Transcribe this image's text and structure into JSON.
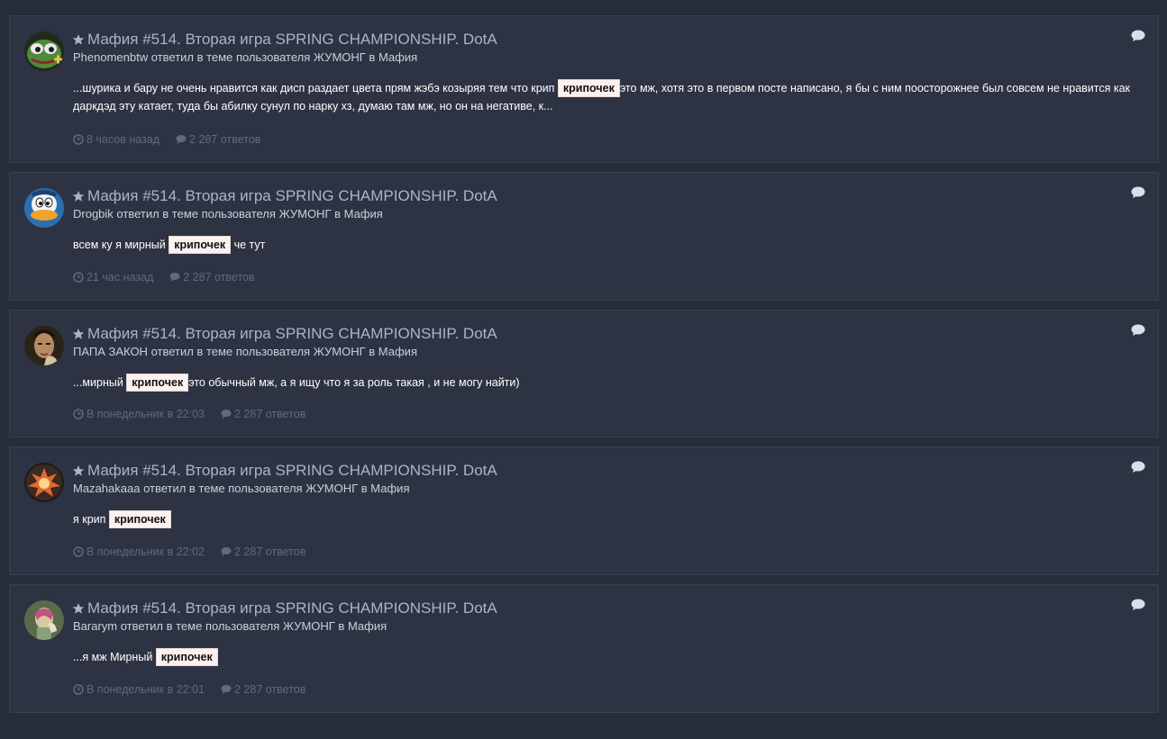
{
  "results": [
    {
      "topic_title": "Мафия #514. Вторая игра SPRING CHAMPIONSHIP. DotA",
      "author": "Phenomenbtw",
      "meta_middle": " ответил в теме пользователя ",
      "topic_author": "ЖУМОНГ",
      "meta_in": " в ",
      "forum": "Мафия",
      "snippet_before": "...шурика и бару не очень нравится как дисп раздает цвета прям жэбэ козыряя тем что крип ",
      "highlight": "крипочек",
      "snippet_after": "это мж, хотя это в первом посте написано, я бы с ним поосторожнее был совсем не нравится как даркдэд эту катает, туда бы абилку сунул по нарку хз, думаю там мж, но он на негативе, к...",
      "time": "8 часов назад",
      "replies": "2 287 ответов",
      "avatar_icon": "frog-avatar-icon"
    },
    {
      "topic_title": "Мафия #514. Вторая игра SPRING CHAMPIONSHIP. DotA",
      "author": "Drogbik",
      "meta_middle": " ответил в теме пользователя ",
      "topic_author": "ЖУМОНГ",
      "meta_in": " в ",
      "forum": "Мафия",
      "snippet_before": "всем ку я мирный ",
      "highlight": "крипочек",
      "snippet_after": " че тут",
      "time": "21 час назад",
      "replies": "2 287 ответов",
      "avatar_icon": "duck-avatar-icon"
    },
    {
      "topic_title": "Мафия #514. Вторая игра SPRING CHAMPIONSHIP. DotA",
      "author": "ПАПА ЗАКОН",
      "meta_middle": " ответил в теме пользователя ",
      "topic_author": "ЖУМОНГ",
      "meta_in": " в ",
      "forum": "Мафия",
      "snippet_before": "...мирный ",
      "highlight": "крипочек",
      "snippet_after": "это обычный мж, а я ищу что я за роль такая , и не могу найти)",
      "time": "В понедельник в 22:03",
      "replies": "2 287 ответов",
      "avatar_icon": "man-avatar-icon"
    },
    {
      "topic_title": "Мафия #514. Вторая игра SPRING CHAMPIONSHIP. DotA",
      "author": "Mazahakaaa",
      "meta_middle": " ответил в теме пользователя ",
      "topic_author": "ЖУМОНГ",
      "meta_in": " в ",
      "forum": "Мафия",
      "snippet_before": "я крип ",
      "highlight": "крипочек",
      "snippet_after": "",
      "time": "В понедельник в 22:02",
      "replies": "2 287 ответов",
      "avatar_icon": "explosion-avatar-icon"
    },
    {
      "topic_title": "Мафия #514. Вторая игра SPRING CHAMPIONSHIP. DotA",
      "author": "Bararym",
      "meta_middle": " ответил в теме пользователя ",
      "topic_author": "ЖУМОНГ",
      "meta_in": " в ",
      "forum": "Мафия",
      "snippet_before": "...я мж Мирный ",
      "highlight": "крипочек",
      "snippet_after": "",
      "time": "В понедельник в 22:01",
      "replies": "2 287 ответов",
      "avatar_icon": "character-avatar-icon"
    }
  ],
  "colors": {
    "page_bg": "#262c38",
    "card_bg": "#2d3342",
    "title": "#aab4c8",
    "muted": "#5e6a7f",
    "highlight_bg": "#fdf1f0"
  }
}
